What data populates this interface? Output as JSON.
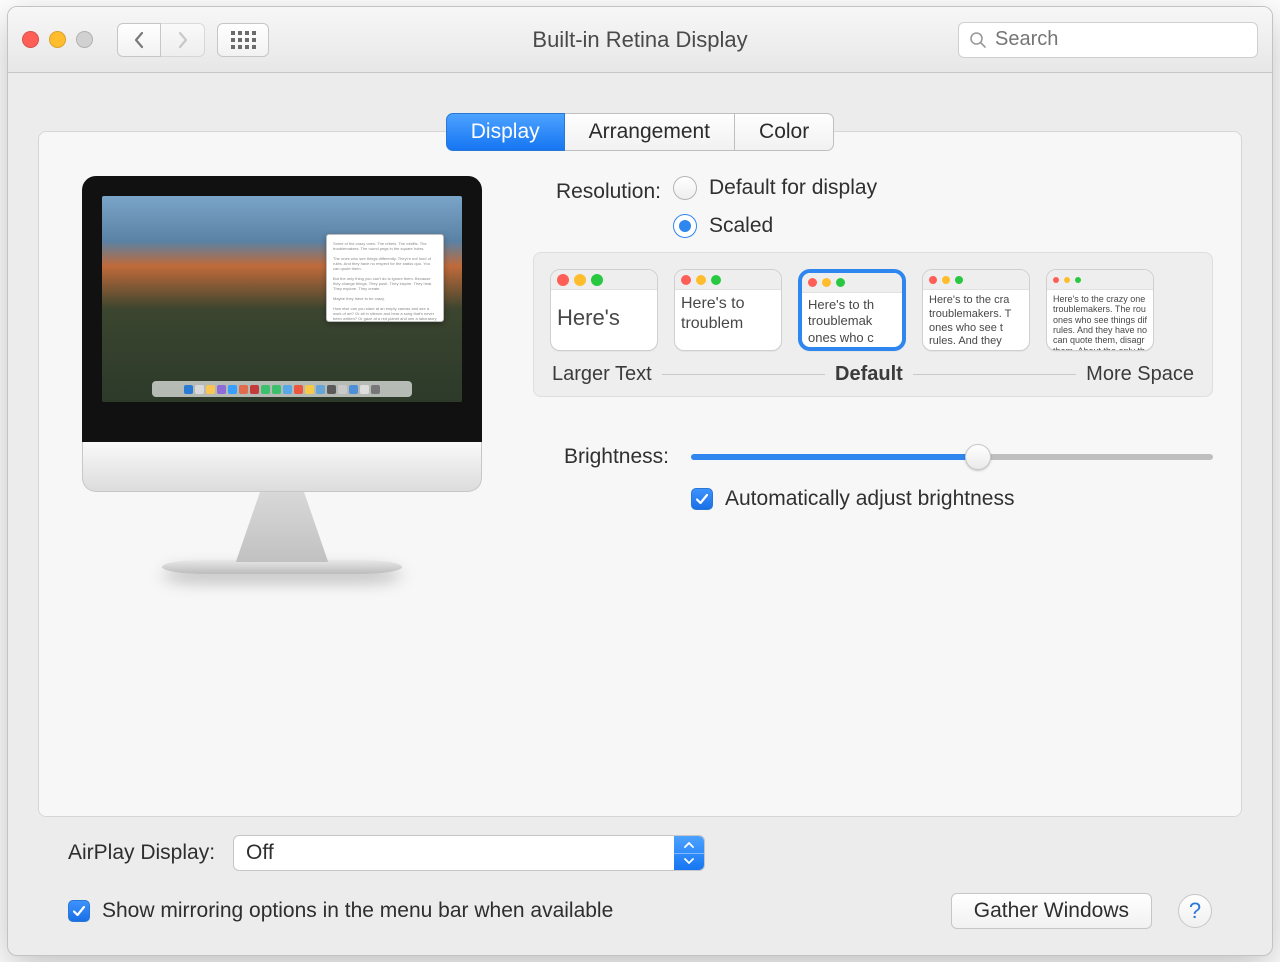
{
  "window": {
    "title": "Built-in Retina Display"
  },
  "search": {
    "placeholder": "Search"
  },
  "tabs": {
    "display": "Display",
    "arrangement": "Arrangement",
    "color": "Color",
    "active": "display"
  },
  "resolution": {
    "label": "Resolution:",
    "default_label": "Default for display",
    "scaled_label": "Scaled",
    "selected": "scaled",
    "legend_left": "Larger Text",
    "legend_mid": "Default",
    "legend_right": "More Space",
    "selected_index": 2,
    "thumbs": {
      "s1": "Here's",
      "s2": "Here's to troublem",
      "s3": "Here's to th troublemak ones who c",
      "s4": "Here's to the cra troublemakers. T ones who see t rules. And they",
      "s5": "Here's to the crazy one troublemakers. The rou ones who see things dif rules. And they have no can quote them, disagr them. About the only th Because they change t"
    }
  },
  "brightness": {
    "label": "Brightness:",
    "percent": 55,
    "auto_label": "Automatically adjust brightness",
    "auto_checked": true
  },
  "airplay": {
    "label": "AirPlay Display:",
    "value": "Off"
  },
  "mirroring": {
    "label": "Show mirroring options in the menu bar when available",
    "checked": true
  },
  "buttons": {
    "gather": "Gather Windows"
  },
  "colors": {
    "accent": "#2f86ef"
  }
}
